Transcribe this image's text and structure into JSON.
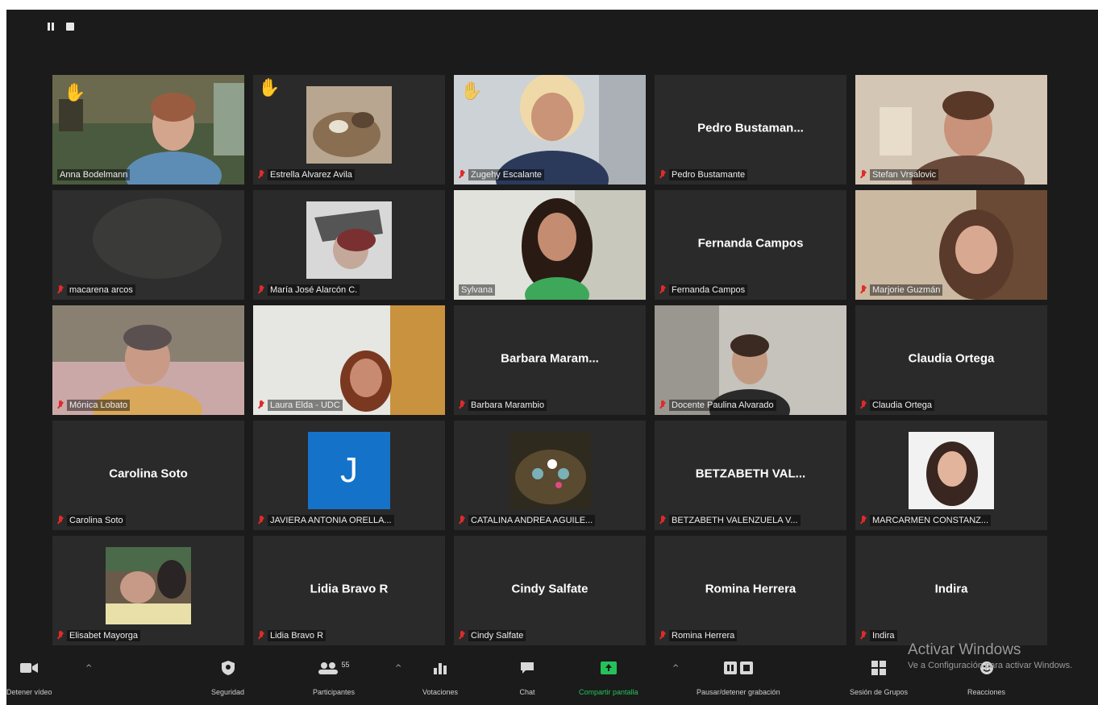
{
  "participants_count": "55",
  "tiles": [
    {
      "label": "Anna Bodelmann",
      "big": ""
    },
    {
      "label": "Estrella Alvarez Avila",
      "big": ""
    },
    {
      "label": "Zugehy Escalante",
      "big": ""
    },
    {
      "label": "Pedro Bustamante",
      "big": "Pedro  Bustaman..."
    },
    {
      "label": "Stefan Vrsalovic",
      "big": ""
    },
    {
      "label": "macarena arcos",
      "big": ""
    },
    {
      "label": "María José Alarcón C.",
      "big": ""
    },
    {
      "label": "Sylvana",
      "big": ""
    },
    {
      "label": "Fernanda Campos",
      "big": "Fernanda Campos"
    },
    {
      "label": "Marjorie Guzmán",
      "big": ""
    },
    {
      "label": "Mónica Lobato",
      "big": ""
    },
    {
      "label": "Laura Elda - UDC",
      "big": ""
    },
    {
      "label": "Barbara Marambio",
      "big": "Barbara  Maram..."
    },
    {
      "label": "Docente Paulina Alvarado",
      "big": ""
    },
    {
      "label": "Claudia Ortega",
      "big": "Claudia Ortega"
    },
    {
      "label": "Carolina Soto",
      "big": "Carolina Soto"
    },
    {
      "label": "JAVIERA ANTONIA ORELLA...",
      "big": "",
      "avatar_letter": "J"
    },
    {
      "label": "CATALINA ANDREA AGUILE...",
      "big": ""
    },
    {
      "label": "BETZABETH VALENZUELA V...",
      "big": "BETZABETH  VAL..."
    },
    {
      "label": "MARCARMEN CONSTANZ...",
      "big": ""
    },
    {
      "label": "Elisabet Mayorga",
      "big": ""
    },
    {
      "label": "Lidia Bravo R",
      "big": "Lidia Bravo R"
    },
    {
      "label": "Cindy Salfate",
      "big": "Cindy Salfate"
    },
    {
      "label": "Romina Herrera",
      "big": "Romina Herrera"
    },
    {
      "label": "Indira",
      "big": "Indira"
    }
  ],
  "toolbar": {
    "video": "Detener vídeo",
    "security": "Seguridad",
    "participants": "Participantes",
    "polls": "Votaciones",
    "chat": "Chat",
    "share": "Compartir pantalla",
    "pause_share": "Pausar/detener grabación",
    "breakout": "Sesión de Grupos",
    "reactions": "Reacciones"
  },
  "watermark": {
    "line1": "Activar Windows",
    "line2": "Ve a Configuración para activar Windows."
  },
  "colors": {
    "active_speaker": "#c8e64a",
    "muted": "#e02b2b",
    "share_green": "#25c25a",
    "avatar_blue": "#1473c9"
  }
}
